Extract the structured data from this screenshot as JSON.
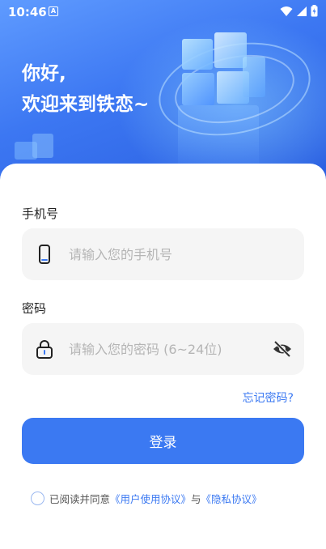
{
  "status_bar": {
    "time": "10:46",
    "a_badge": "A"
  },
  "hero": {
    "greeting_line1": "你好,",
    "greeting_line2": "欢迎来到铁恋~"
  },
  "form": {
    "phone": {
      "label": "手机号",
      "placeholder": "请输入您的手机号",
      "value": "",
      "icon": "phone-icon"
    },
    "password": {
      "label": "密码",
      "placeholder": "请输入您的密码 (6~24位)",
      "value": "",
      "icon": "lock-icon",
      "toggle_icon": "eye-off-icon"
    },
    "forgot_label": "忘记密码?",
    "login_label": "登录"
  },
  "agreement": {
    "prefix": "已阅读并同意",
    "user_agreement": "《用户使用协议》",
    "and": "与",
    "privacy_policy": "《隐私协议》",
    "checked": false
  },
  "colors": {
    "accent": "#3b79f2",
    "field_bg": "#f5f5f5",
    "placeholder": "#b5b5b5"
  }
}
